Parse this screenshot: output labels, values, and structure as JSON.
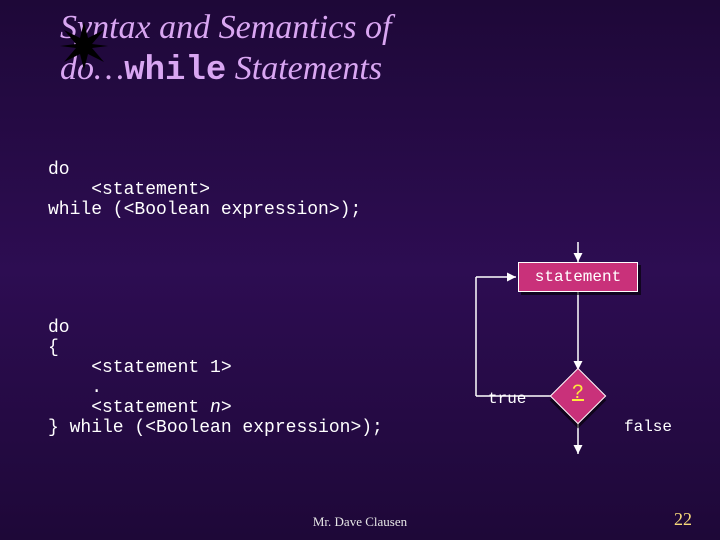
{
  "title": {
    "line1_pre": "Syntax and Semantics of",
    "line2_pre": "do…",
    "line2_kw": "while",
    "line2_post": " Statements"
  },
  "code1": {
    "l1": "do",
    "l2": "    <statement>",
    "l3": "while (<Boolean expression>);"
  },
  "code2": {
    "l1": "do",
    "l2": "{",
    "l3": "    <statement 1>",
    "l4": "    .",
    "l5_a": "    <statement ",
    "l5_em": "n",
    "l5_b": ">",
    "l6": "} while (<Boolean expression>);"
  },
  "diagram": {
    "statement": "statement",
    "question": "?",
    "true": "true",
    "false": "false"
  },
  "footer": {
    "author": "Mr. Dave Clausen",
    "page": "22"
  }
}
